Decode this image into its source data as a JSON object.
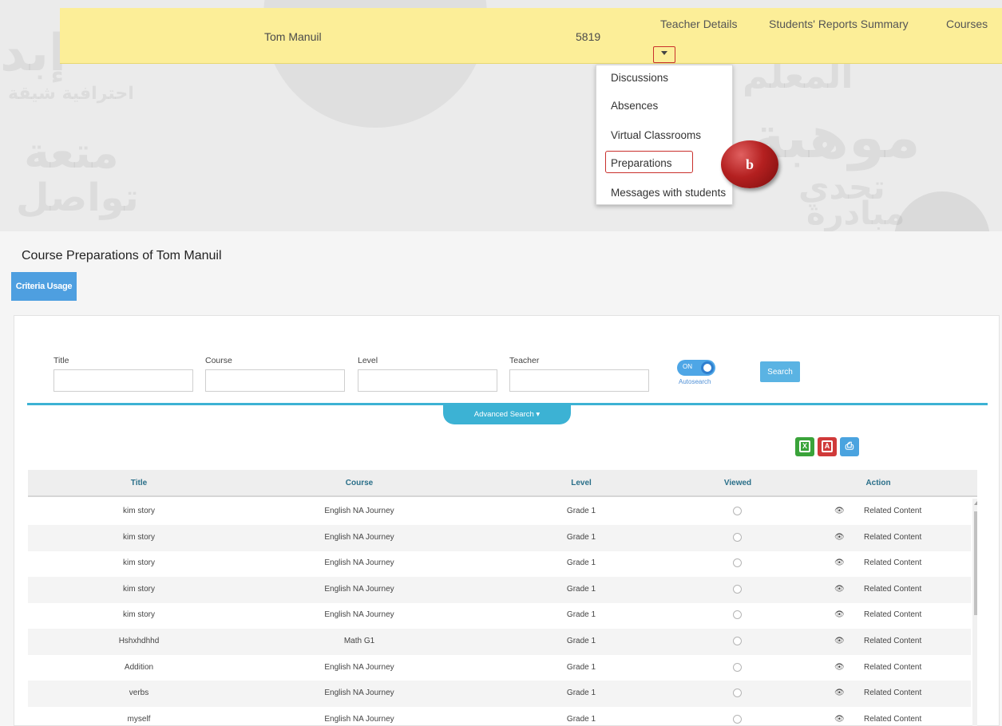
{
  "topbar": {
    "name": "Tom Manuil",
    "id": "5819",
    "links": [
      "Teacher Details",
      "Students' Reports Summary",
      "Courses"
    ]
  },
  "dropdown": {
    "items": [
      "Discussions",
      "Absences",
      "Virtual Classrooms",
      "Preparations",
      "Messages with students"
    ],
    "highlighted": "Preparations"
  },
  "callout": {
    "label": "b"
  },
  "page": {
    "title": "Course Preparations of Tom Manuil",
    "criteria_button": "Criteria Usage"
  },
  "filters": {
    "labels": [
      "Title",
      "Course",
      "Level",
      "Teacher"
    ],
    "values": [
      "",
      "",
      "",
      ""
    ],
    "toggle_state": "ON",
    "toggle_label": "Autosearch",
    "search_button": "Search",
    "advanced_search": "Advanced Search ▾"
  },
  "exports": {
    "excel": "X",
    "pdf": "A",
    "print": "⎙",
    "colors": {
      "excel": "#3aa33a",
      "pdf": "#d03a3a",
      "print": "#4aa3df"
    }
  },
  "table": {
    "columns": [
      "Title",
      "Course",
      "Level",
      "Viewed",
      "Action"
    ],
    "rows": [
      {
        "title": "kim story",
        "course": "English NA Journey",
        "level": "Grade 1",
        "action": "Related Content"
      },
      {
        "title": "kim story",
        "course": "English NA Journey",
        "level": "Grade 1",
        "action": "Related Content"
      },
      {
        "title": "kim story",
        "course": "English NA Journey",
        "level": "Grade 1",
        "action": "Related Content"
      },
      {
        "title": "kim story",
        "course": "English NA Journey",
        "level": "Grade 1",
        "action": "Related Content"
      },
      {
        "title": "kim story",
        "course": "English NA Journey",
        "level": "Grade 1",
        "action": "Related Content"
      },
      {
        "title": "Hshxhdhhd",
        "course": "Math G1",
        "level": "Grade 1",
        "action": "Related Content"
      },
      {
        "title": "Addition",
        "course": "English NA Journey",
        "level": "Grade 1",
        "action": "Related Content"
      },
      {
        "title": "verbs",
        "course": "English NA Journey",
        "level": "Grade 1",
        "action": "Related Content"
      },
      {
        "title": "myself",
        "course": "English NA Journey",
        "level": "Grade 1",
        "action": "Related Content"
      }
    ]
  },
  "colors": {
    "topbar": "#fcee98",
    "accent": "#3cb2d4",
    "primary_button": "#4e9fe0",
    "highlight_border": "#c9302c"
  }
}
